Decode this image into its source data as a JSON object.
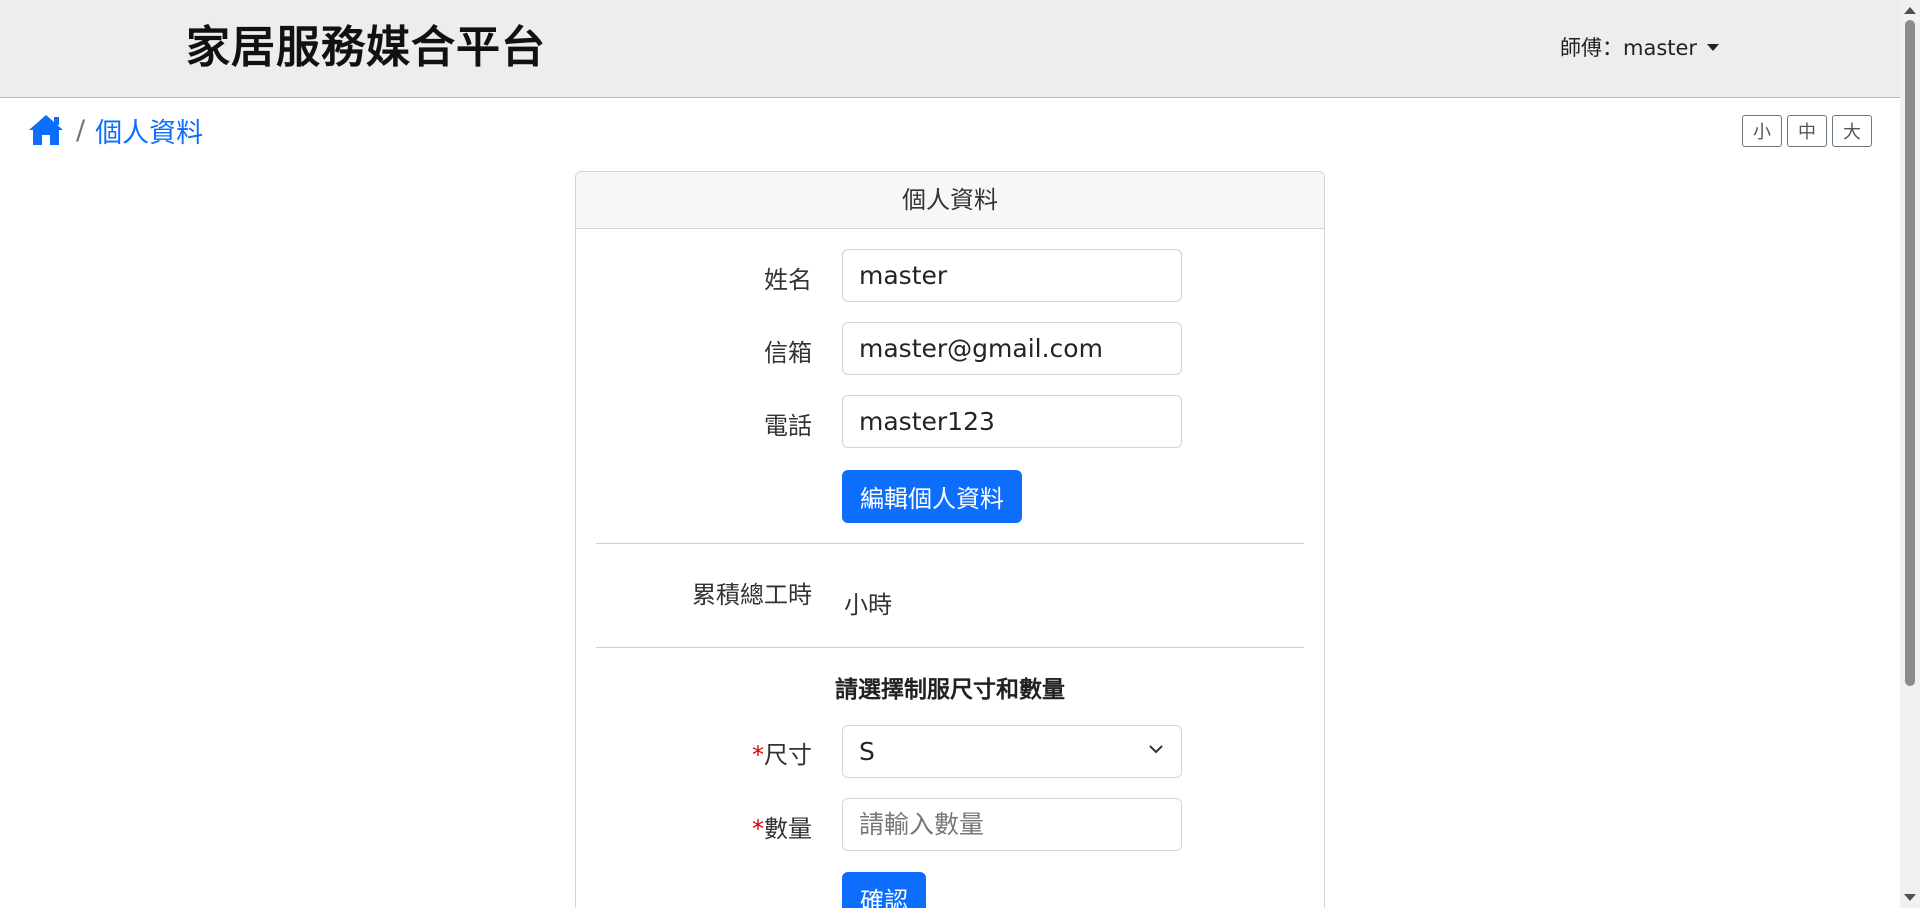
{
  "navbar": {
    "brand": "家居服務媒合平台",
    "user_label": "師傅：master"
  },
  "breadcrumb": {
    "home_icon": "home-icon",
    "separator": "/",
    "current": "個人資料"
  },
  "font_size_buttons": [
    {
      "label": "小"
    },
    {
      "label": "中"
    },
    {
      "label": "大"
    }
  ],
  "card": {
    "header": "個人資料",
    "profile": {
      "name_label": "姓名",
      "name_value": "master",
      "email_label": "信箱",
      "email_value": "master@gmail.com",
      "phone_label": "電話",
      "phone_value": "master123",
      "edit_button": "編輯個人資料"
    },
    "work_hours": {
      "label": "累積總工時",
      "unit": "小時"
    },
    "uniform": {
      "title": "請選擇制服尺寸和數量",
      "required_mark": "*",
      "size_label": "尺寸",
      "size_value": "S",
      "quantity_label": "數量",
      "quantity_placeholder": "請輸入數量",
      "confirm_button": "確認"
    }
  },
  "colors": {
    "primary": "#0d6efd",
    "navbar_bg": "#eeedeb",
    "required": "#e00000"
  }
}
